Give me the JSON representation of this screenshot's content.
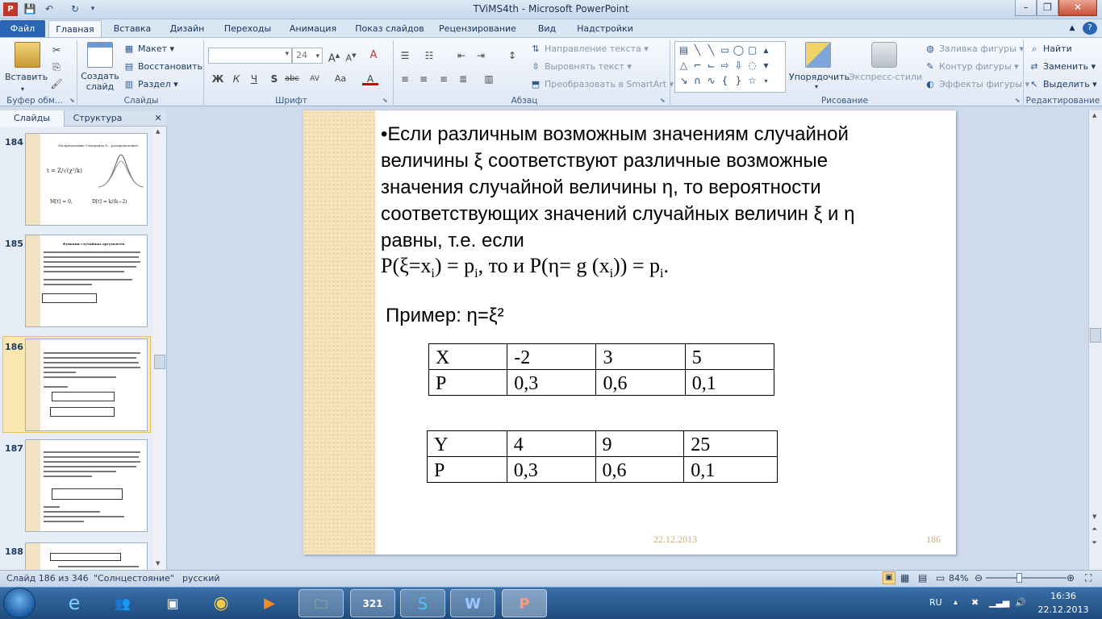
{
  "window": {
    "title": "TViMS4th  -  Microsoft PowerPoint",
    "controls": [
      "–",
      "❐",
      "✕"
    ]
  },
  "qat": {
    "save": "💾",
    "undo": "↶",
    "redo": "↻"
  },
  "tabs": {
    "file": "Файл",
    "home": "Главная",
    "insert": "Вставка",
    "design": "Дизайн",
    "transitions": "Переходы",
    "animation": "Анимация",
    "slideshow": "Показ слайдов",
    "review": "Рецензирование",
    "view": "Вид",
    "addins": "Надстройки"
  },
  "ribbon": {
    "clipboard": {
      "label": "Буфер обм...",
      "paste": "Вставить"
    },
    "slides": {
      "label": "Слайды",
      "new_slide": "Создать слайд",
      "layout": "Макет",
      "reset": "Восстановить",
      "section": "Раздел"
    },
    "font": {
      "label": "Шрифт",
      "font_name": "",
      "font_size": "24",
      "bold": "Ж",
      "italic": "К",
      "underline": "Ч",
      "strike": "S",
      "abc": "abc",
      "spacing": "AV",
      "case": "Aa",
      "color": "A"
    },
    "paragraph": {
      "label": "Абзац",
      "text_direction": "Направление текста",
      "align_text": "Выровнять текст",
      "smartart": "Преобразовать в SmartArt"
    },
    "drawing": {
      "label": "Рисование",
      "arrange": "Упорядочить",
      "quick_styles": "Экспресс-стили",
      "fill": "Заливка фигуры",
      "outline": "Контур фигуры",
      "effects": "Эффекты фигуры"
    },
    "editing": {
      "label": "Редактирование",
      "find": "Найти",
      "replace": "Заменить",
      "select": "Выделить"
    }
  },
  "panel": {
    "tab_slides": "Слайды",
    "tab_outline": "Структура",
    "close": "✕",
    "thumbs": [
      {
        "num": "184",
        "title": "Распределение Стьюдента (t – распределение)"
      },
      {
        "num": "185",
        "title": "Функции случайных аргументов"
      },
      {
        "num": "186",
        "title": ""
      },
      {
        "num": "187",
        "title": ""
      },
      {
        "num": "188",
        "title": ""
      }
    ]
  },
  "slide": {
    "para_lines": [
      "•Если различным возможным значениям случайной",
      "величины ξ соответствуют различные возможные",
      "значения случайной величины η, то вероятности",
      "соответствующих значений случайных величин ξ и η",
      "равны, т.е. если"
    ],
    "formula": {
      "a": "P(ξ=x",
      "i1": "i",
      "b": ") = p",
      "i2": "i",
      "c": ",   то и  P(η= g (x",
      "i3": "i",
      "d": ")) = p",
      "i4": "i",
      "e": "."
    },
    "example": "Пример: η=ξ²",
    "table_x": [
      [
        "X",
        "-2",
        "3",
        "5"
      ],
      [
        "P",
        "0,3",
        "0,6",
        "0,1"
      ]
    ],
    "table_y": [
      [
        "Y",
        "4",
        "9",
        "25"
      ],
      [
        "P",
        "0,3",
        "0,6",
        "0,1"
      ]
    ],
    "date": "22.12.2013",
    "num": "186"
  },
  "status": {
    "slide_of": "Слайд 186 из 346",
    "theme": "\"Солнцестояние\"",
    "lang": "русский",
    "zoom": "84%",
    "zoom_level": 0.84
  },
  "tray": {
    "lang": "RU",
    "time": "16:36",
    "date": "22.12.2013"
  }
}
